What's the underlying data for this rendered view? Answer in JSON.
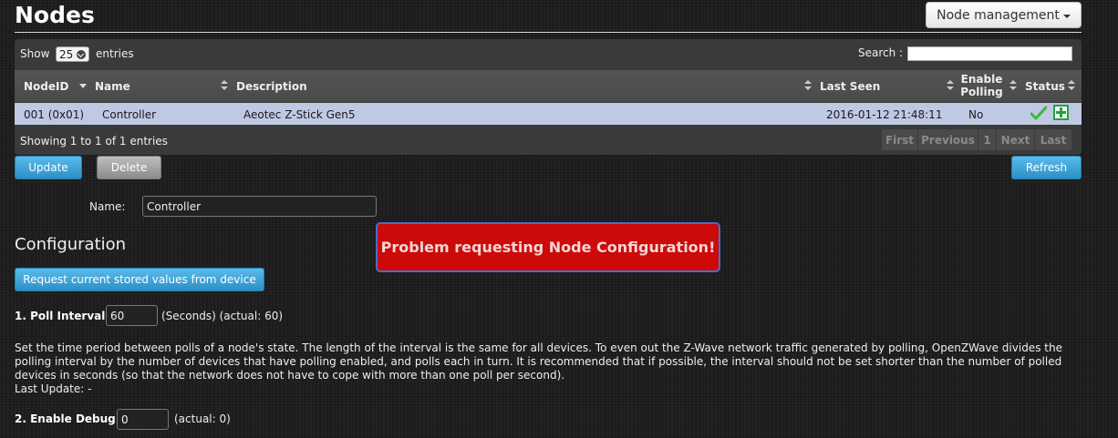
{
  "header": {
    "title": "Nodes",
    "node_management_label": "Node management"
  },
  "table": {
    "show_label": "Show",
    "entries_value": "25",
    "entries_label": "entries",
    "search_label": "Search :",
    "search_value": "",
    "columns": [
      "NodeID",
      "Name",
      "Description",
      "Last Seen",
      "Enable Polling",
      "Status"
    ],
    "enable_polling_line1": "Enable",
    "enable_polling_line2": "Polling",
    "rows": [
      {
        "node_id": "001 (0x01)",
        "name": "Controller",
        "description": "Aeotec Z-Stick Gen5",
        "last_seen": "2016-01-12 21:48:11",
        "enable_polling": "No",
        "status_icons": [
          "check-icon",
          "plus-icon"
        ]
      }
    ],
    "info": "Showing 1 to 1 of 1 entries",
    "pagination": [
      "First",
      "Previous",
      "1",
      "Next",
      "Last"
    ]
  },
  "actions": {
    "update_label": "Update",
    "delete_label": "Delete",
    "refresh_label": "Refresh"
  },
  "node_form": {
    "name_label": "Name:",
    "name_value": "Controller"
  },
  "configuration": {
    "heading": "Configuration",
    "request_button_label": "Request current stored values from device",
    "error_message": "Problem requesting Node Configuration!",
    "params": [
      {
        "label": "1. Poll Interval:",
        "value": "60",
        "note": "(Seconds) (actual: 60)",
        "description": "Set the time period between polls of a node's state. The length of the interval is the same for all devices. To even out the Z-Wave network traffic generated by polling, OpenZWave divides the polling interval by the number of devices that have polling enabled, and polls each in turn. It is recommended that if possible, the interval should not be set shorter than the number of polled devices in seconds (so that the network does not have to cope with more than one poll per second).",
        "last_update": "Last Update: -"
      },
      {
        "label": "2. Enable Debug:",
        "value": "0",
        "note": "(actual: 0)"
      }
    ]
  },
  "colors": {
    "background": "#1e1e1e",
    "selected_row": "#bfc9e3",
    "error_bg": "#cc0a0a",
    "error_border": "#4b6ec8",
    "primary_button": "#2b8fc8",
    "status_green": "#1ea53a"
  }
}
